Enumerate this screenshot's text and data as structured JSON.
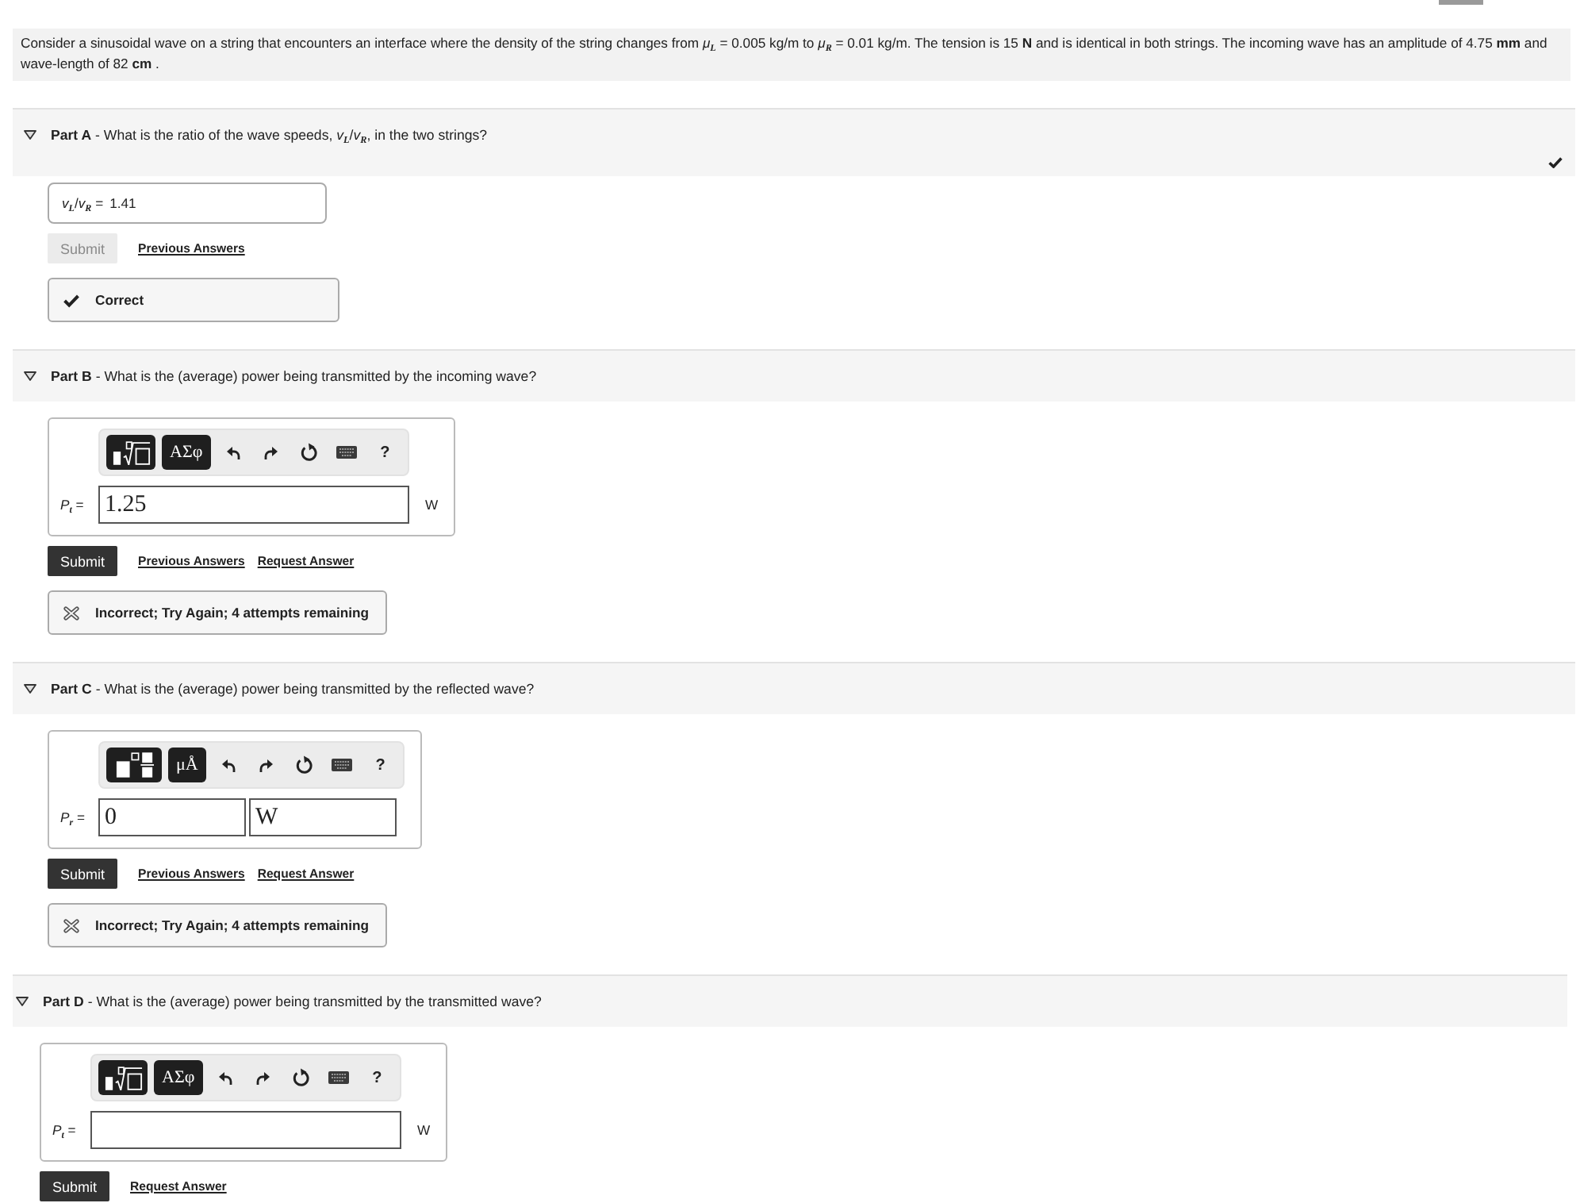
{
  "problem": "Consider a sinusoidal wave on a string that encounters an interface where the density of the string changes from *μ*$_{L}$ = 0.005 kg/m to *μ*$_{R}$ = 0.01 kg/m. The tension is 15 **N** and is identical in both strings. The incoming wave has an amplitude of 4.75 **mm** and wave-length of 82 **cm** .",
  "parts": [
    {
      "title": "**Part A** - What is the ratio of the wave speeds, *v*$_{L}$/*v*$_{R}$, in the two strings?",
      "expanded": true,
      "completed": true,
      "answer": {
        "kind": "plain",
        "label": "*v*$_{L}$/*v*$_{R}$ =",
        "value": "1.41"
      },
      "submit": {
        "label": "Submit",
        "disabled": true
      },
      "links": [
        "Previous Answers"
      ],
      "feedback": {
        "kind": "correct",
        "text": "Correct"
      }
    },
    {
      "title": "**Part B** - What is the (average) power being transmitted by the incoming wave?",
      "expanded": true,
      "completed": false,
      "answer": {
        "kind": "math",
        "toolbar": [
          {
            "kind": "template-radical"
          },
          {
            "kind": "symbols",
            "label": "ΑΣφ"
          },
          {
            "kind": "undo"
          },
          {
            "kind": "redo"
          },
          {
            "kind": "reset"
          },
          {
            "kind": "keyboard"
          },
          {
            "kind": "help",
            "label": "?"
          }
        ],
        "label": "*P*$_{t}$ =",
        "value": "1.25",
        "unit": "W"
      },
      "submit": {
        "label": "Submit",
        "disabled": false
      },
      "links": [
        "Previous Answers",
        "Request Answer"
      ],
      "feedback": {
        "kind": "incorrect",
        "text": "Incorrect; Try Again; 4 attempts remaining"
      }
    },
    {
      "title": "**Part C** - What is the (average) power being transmitted by the reflected wave?",
      "expanded": true,
      "completed": false,
      "answer": {
        "kind": "math-units",
        "toolbar": [
          {
            "kind": "template-units"
          },
          {
            "kind": "symbols",
            "label": "μÅ"
          },
          {
            "kind": "undo"
          },
          {
            "kind": "redo"
          },
          {
            "kind": "reset"
          },
          {
            "kind": "keyboard"
          },
          {
            "kind": "help",
            "label": "?"
          }
        ],
        "label": "*P*$_{r}$ =",
        "value": "0",
        "unit_value": "W"
      },
      "submit": {
        "label": "Submit",
        "disabled": false
      },
      "links": [
        "Previous Answers",
        "Request Answer"
      ],
      "feedback": {
        "kind": "incorrect",
        "text": "Incorrect; Try Again; 4 attempts remaining"
      }
    },
    {
      "title": "**Part D** - What is the (average) power being transmitted by the transmitted wave?",
      "expanded": true,
      "completed": false,
      "answer": {
        "kind": "math",
        "toolbar": [
          {
            "kind": "template-radical"
          },
          {
            "kind": "symbols",
            "label": "ΑΣφ"
          },
          {
            "kind": "undo"
          },
          {
            "kind": "redo"
          },
          {
            "kind": "reset"
          },
          {
            "kind": "keyboard"
          },
          {
            "kind": "help",
            "label": "?"
          }
        ],
        "label": "*P*$_{t}$ =",
        "unit": "W"
      },
      "submit": {
        "label": "Submit",
        "disabled": false
      },
      "links": [
        "Request Answer"
      ]
    }
  ]
}
